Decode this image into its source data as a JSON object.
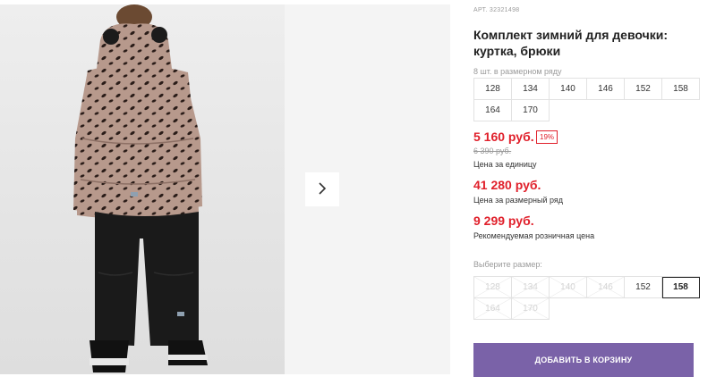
{
  "product": {
    "article": "АРТ. 32321498",
    "title": "Комплект зимний для девочки: куртка, брюки",
    "pack_note": "8 шт. в размерном ряду",
    "pack_sizes": [
      "128",
      "134",
      "140",
      "146",
      "152",
      "158",
      "164",
      "170"
    ]
  },
  "prices": {
    "unit_price": "5 160 руб.",
    "discount": "19%",
    "old_price": "6 390 руб.",
    "unit_caption": "Цена за единицу",
    "row_price": "41 280 руб.",
    "row_caption": "Цена за размерный ряд",
    "retail_price": "9 299 руб.",
    "retail_caption": "Рекомендуемая розничная цена"
  },
  "size_select": {
    "label": "Выберите размер:",
    "options": [
      {
        "label": "128",
        "available": false,
        "selected": false
      },
      {
        "label": "134",
        "available": false,
        "selected": false
      },
      {
        "label": "140",
        "available": false,
        "selected": false
      },
      {
        "label": "146",
        "available": false,
        "selected": false
      },
      {
        "label": "152",
        "available": true,
        "selected": false
      },
      {
        "label": "158",
        "available": true,
        "selected": true
      },
      {
        "label": "164",
        "available": false,
        "selected": false
      },
      {
        "label": "170",
        "available": false,
        "selected": false
      }
    ]
  },
  "actions": {
    "add_to_cart": "ДОБАВИТЬ В КОРЗИНУ"
  },
  "gallery": {
    "next_icon": "chevron-right-icon"
  },
  "colors": {
    "price_red": "#e0202b",
    "button_purple": "#7a62a8",
    "jacket": "#b5978a",
    "pants": "#1a1a1a"
  }
}
